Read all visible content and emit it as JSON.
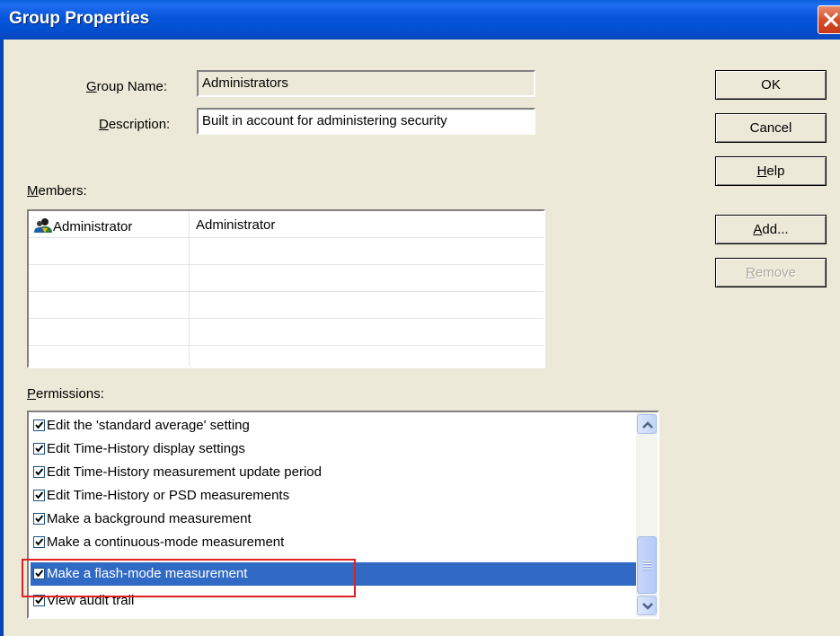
{
  "window": {
    "title": "Group Properties"
  },
  "form": {
    "group_name_label_pre": "",
    "group_name_label_accel": "G",
    "group_name_label_post": "roup Name:",
    "group_name_value": "Administrators",
    "description_label_accel": "D",
    "description_label_post": "escription:",
    "description_value": "Built in account for administering security"
  },
  "buttons": {
    "ok": "OK",
    "cancel": "Cancel",
    "help_accel": "H",
    "help_post": "elp",
    "add_accel": "A",
    "add_post": "dd...",
    "remove_accel": "R",
    "remove_post": "emove"
  },
  "members": {
    "label_accel": "M",
    "label_post": "embers:",
    "rows": [
      {
        "name": "Administrator",
        "full_name": "Administrator"
      }
    ]
  },
  "permissions": {
    "label_accel": "P",
    "label_post": "ermissions:",
    "items": [
      {
        "label": "Edit the 'standard average' setting",
        "checked": true
      },
      {
        "label": "Edit Time-History display settings",
        "checked": true
      },
      {
        "label": "Edit Time-History measurement update period",
        "checked": true
      },
      {
        "label": "Edit Time-History or PSD measurements",
        "checked": true
      },
      {
        "label": "Make a background measurement",
        "checked": true
      },
      {
        "label": "Make a continuous-mode measurement",
        "checked": true
      },
      {
        "label": "Make a flash-mode measurement",
        "checked": true,
        "selected": true
      },
      {
        "label": "View audit trail",
        "checked": true
      }
    ]
  },
  "colors": {
    "selection": "#316ac5",
    "annotation_box": "#e02020",
    "dialog_bg": "#ece9d8"
  }
}
